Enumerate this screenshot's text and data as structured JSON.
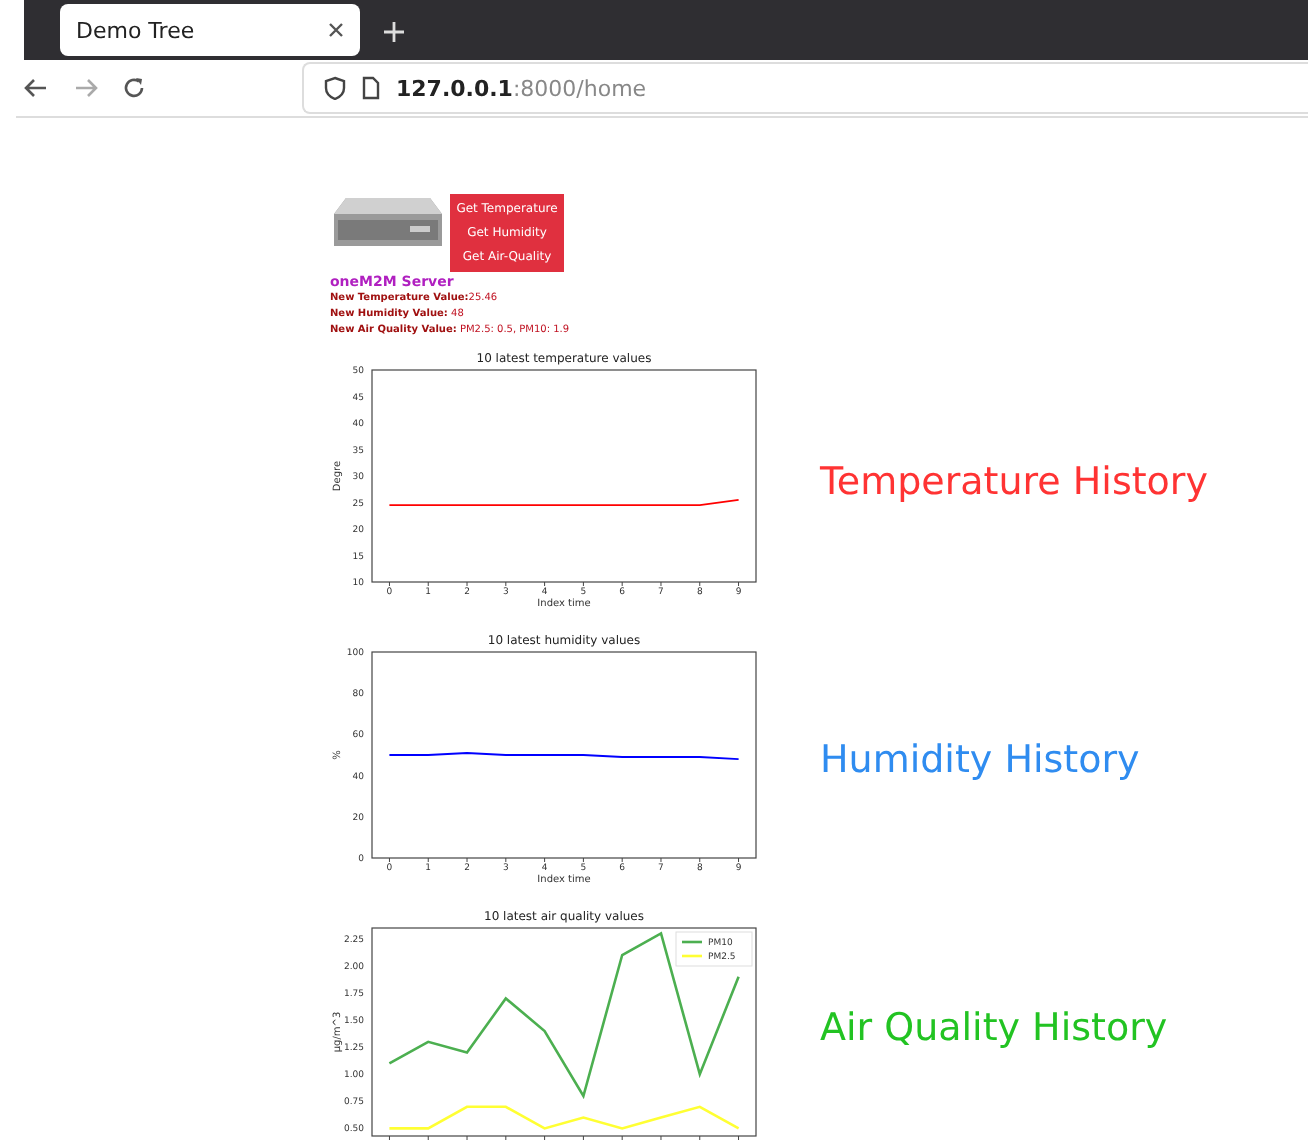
{
  "browser": {
    "tab_title": "Demo Tree",
    "url_host": "127.0.0.1",
    "url_rest": ":8000/home"
  },
  "server": {
    "title": "oneM2M Server",
    "buttons": [
      "Get Temperature",
      "Get Humidity",
      "Get Air-Quality"
    ],
    "readings": [
      {
        "label": "New Temperature Value:",
        "value": "25.46"
      },
      {
        "label": "New Humidity Value:",
        "value": " 48"
      },
      {
        "label": "New Air Quality Value:",
        "value": " PM2.5: 0.5, PM10: 1.9"
      }
    ]
  },
  "histories": [
    {
      "label": "Temperature History",
      "color": "#ff3333",
      "chart_data": {
        "type": "line",
        "title": "10 latest temperature values",
        "xlabel": "Index time",
        "ylabel": "Degre",
        "x": [
          0,
          1,
          2,
          3,
          4,
          5,
          6,
          7,
          8,
          9
        ],
        "series": [
          {
            "color": "#ff0000",
            "values": [
              24.5,
              24.5,
              24.5,
              24.5,
              24.5,
              24.5,
              24.5,
              24.5,
              24.5,
              25.5
            ]
          }
        ],
        "ylim": [
          10,
          50
        ],
        "xlim": [
          -0.45,
          9.45
        ],
        "yticks": [
          10,
          15,
          20,
          25,
          30,
          35,
          40,
          45,
          50
        ],
        "xticks": [
          0,
          1,
          2,
          3,
          4,
          5,
          6,
          7,
          8,
          9
        ]
      }
    },
    {
      "label": "Humidity History",
      "color": "#2f8cf0",
      "chart_data": {
        "type": "line",
        "title": "10 latest humidity values",
        "xlabel": "Index time",
        "ylabel": "%",
        "x": [
          0,
          1,
          2,
          3,
          4,
          5,
          6,
          7,
          8,
          9
        ],
        "series": [
          {
            "color": "#0000ff",
            "values": [
              50,
              50,
              51,
              50,
              50,
              50,
              49,
              49,
              49,
              48
            ]
          }
        ],
        "ylim": [
          0,
          100
        ],
        "xlim": [
          -0.45,
          9.45
        ],
        "yticks": [
          0,
          20,
          40,
          60,
          80,
          100
        ],
        "xticks": [
          0,
          1,
          2,
          3,
          4,
          5,
          6,
          7,
          8,
          9
        ]
      }
    },
    {
      "label": "Air Quality History",
      "color": "#22c322",
      "chart_data": {
        "type": "line",
        "title": "10 latest air quality values",
        "ylabel": "μg/m^3",
        "x": [
          0,
          1,
          2,
          3,
          4,
          5,
          6,
          7,
          8,
          9
        ],
        "series": [
          {
            "name": "PM10",
            "color": "#4caf50",
            "values": [
              1.1,
              1.3,
              1.2,
              1.7,
              1.4,
              0.8,
              2.1,
              2.3,
              1.0,
              1.9
            ]
          },
          {
            "name": "PM2.5",
            "color": "#ffff33",
            "values": [
              0.5,
              0.5,
              0.7,
              0.7,
              0.5,
              0.6,
              0.5,
              0.6,
              0.7,
              0.5
            ]
          }
        ],
        "ylim": [
          0.43,
          2.35
        ],
        "yticks": [
          {
            "value": 0.5,
            "label": "0.50"
          },
          {
            "value": 0.75,
            "label": "0.75"
          },
          {
            "value": 1.0,
            "label": "1.00"
          },
          {
            "value": 1.25,
            "label": "1.25"
          },
          {
            "value": 1.5,
            "label": "1.50"
          },
          {
            "value": 1.75,
            "label": "1.75"
          },
          {
            "value": 2.0,
            "label": "2.00"
          },
          {
            "value": 2.25,
            "label": "2.25"
          }
        ],
        "xlim": [
          -0.45,
          9.45
        ],
        "legend": true
      }
    }
  ]
}
